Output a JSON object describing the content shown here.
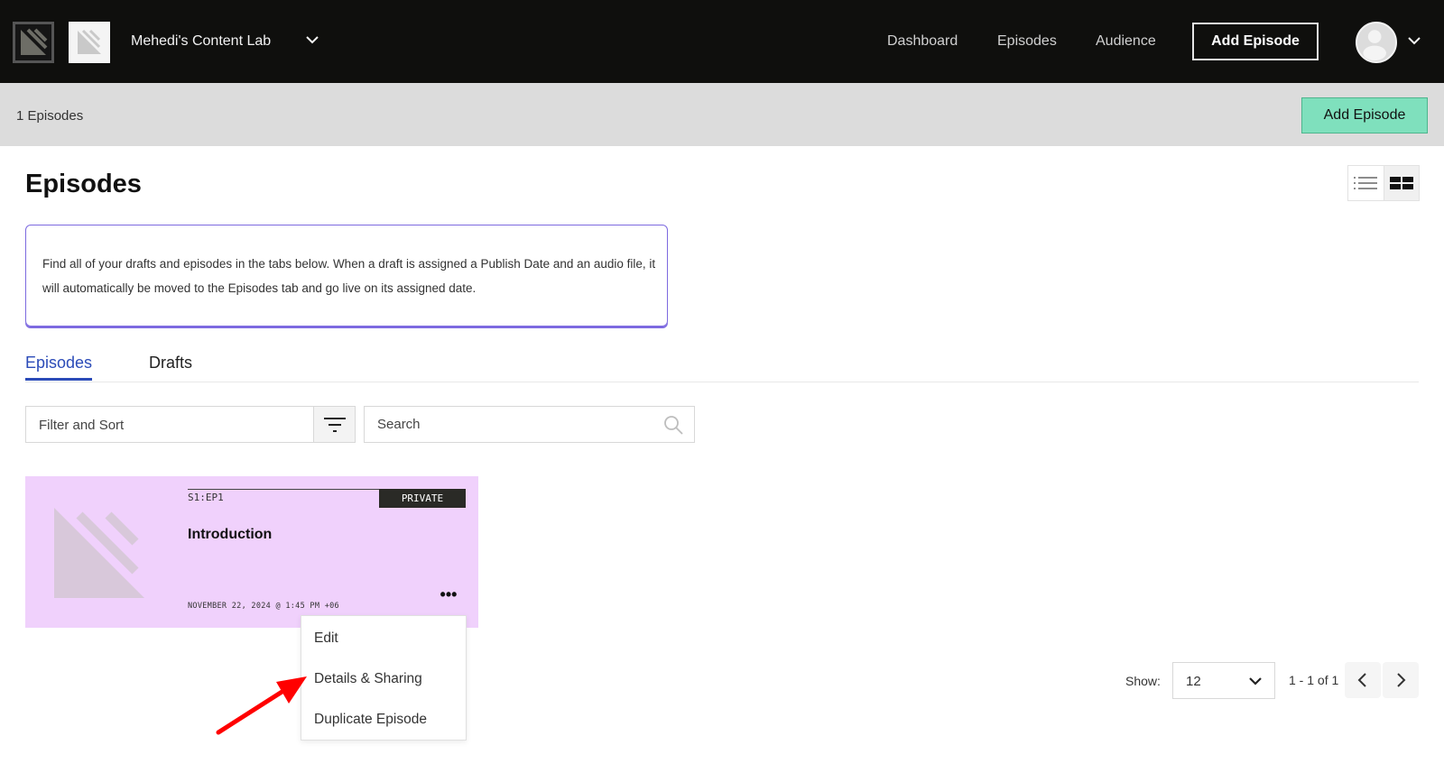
{
  "topnav": {
    "show_name": "Mehedi's Content Lab",
    "links": [
      {
        "label": "Dashboard"
      },
      {
        "label": "Episodes"
      },
      {
        "label": "Audience"
      }
    ],
    "add_episode_label": "Add Episode",
    "icons": {
      "logo": "platform-logo-icon",
      "show_art": "show-artwork-icon",
      "show_switcher": "chevron-down-icon",
      "avatar": "user-avatar-icon",
      "account_menu": "chevron-down-icon"
    }
  },
  "subbar": {
    "episode_count": "1 Episodes",
    "add_episode_label": "Add Episode",
    "accent_color": "#7fe0bd"
  },
  "main": {
    "title": "Episodes",
    "view_toggle": [
      {
        "name": "list-view",
        "icon": "list-icon",
        "active": false
      },
      {
        "name": "grid-view",
        "icon": "grid-icon",
        "active": true
      }
    ],
    "info_text": "Find all of your drafts and episodes in the tabs below. When a draft is assigned a Publish Date and an audio file, it will automatically be moved to the Episodes tab and go live on its assigned date.",
    "tabs": [
      {
        "label": "Episodes",
        "active": true
      },
      {
        "label": "Drafts",
        "active": false
      }
    ],
    "filter": {
      "label": "Filter and Sort",
      "icon": "filter-icon"
    },
    "search": {
      "placeholder": "Search",
      "value": "",
      "icon": "search-icon"
    }
  },
  "episodes": [
    {
      "number": "S1:EP1",
      "status": "PRIVATE",
      "title": "Introduction",
      "date": "NOVEMBER 22, 2024 @ 1:45 PM +06",
      "more_label": "•••",
      "card_color": "#f0d1fc"
    }
  ],
  "context_menu": {
    "items": [
      {
        "label": "Edit"
      },
      {
        "label": "Details & Sharing"
      },
      {
        "label": "Duplicate Episode"
      }
    ]
  },
  "annotation": {
    "type": "red-arrow",
    "points_to": "Details & Sharing",
    "color": "#ff0000"
  },
  "pagination": {
    "show_label": "Show:",
    "page_size": "12",
    "range": "1 - 1 of 1",
    "prev_icon": "chevron-left-icon",
    "next_icon": "chevron-right-icon"
  }
}
